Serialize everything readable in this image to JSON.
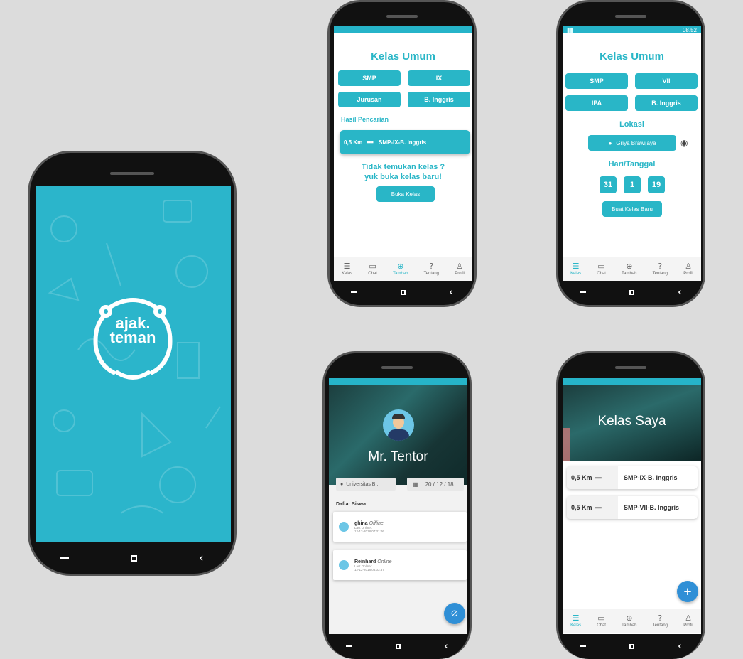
{
  "splash": {
    "logo_line1": "ajak.",
    "logo_line2": "teman"
  },
  "nav_labels": {
    "kelas": "Kelas",
    "chat": "Chat",
    "tambah": "Tambah",
    "tentang": "Tentang",
    "profil": "Profil"
  },
  "screen_search": {
    "title": "Kelas Umum",
    "filters": [
      "SMP",
      "IX",
      "Jurusan",
      "B. Inggris"
    ],
    "results_heading": "Hasil Pencarian",
    "result": {
      "distance": "0,5 Km",
      "class": "SMP-IX-B. Inggris"
    },
    "not_found_line1": "Tidak temukan kelas ?",
    "not_found_line2": "yuk buka kelas baru!",
    "open_button": "Buka Kelas"
  },
  "screen_create": {
    "status_time": "08.52",
    "title": "Kelas Umum",
    "filters": [
      "SMP",
      "VII",
      "IPA",
      "B. Inggris"
    ],
    "location_heading": "Lokasi",
    "location_value": "Griya Brawijaya",
    "date_heading": "Hari/Tanggal",
    "date": [
      "31",
      "1",
      "19"
    ],
    "create_button": "Buat Kelas Baru"
  },
  "screen_tentor": {
    "name": "Mr. Tentor",
    "location": "Universitas B...",
    "date": "20 / 12 / 18",
    "list_heading": "Daftar Siswa",
    "students": [
      {
        "name": "ghina",
        "status": "Offline",
        "last_label": "Last Online :",
        "last_time": "12-12-2018 07:31:06"
      },
      {
        "name": "Reinhard",
        "status": "Online",
        "last_label": "Last Online :",
        "last_time": "12-12-2018 05:03:37"
      }
    ]
  },
  "screen_mine": {
    "title": "Kelas Saya",
    "classes": [
      {
        "distance": "0,5 Km",
        "class": "SMP-IX-B. Inggris"
      },
      {
        "distance": "0,5 Km",
        "class": "SMP-VII-B. Inggris"
      }
    ],
    "fab": "+"
  },
  "colors": {
    "teal": "#29b6c7",
    "splash_bg": "#2bb5cb",
    "dark_header": "#1e4a4a"
  }
}
